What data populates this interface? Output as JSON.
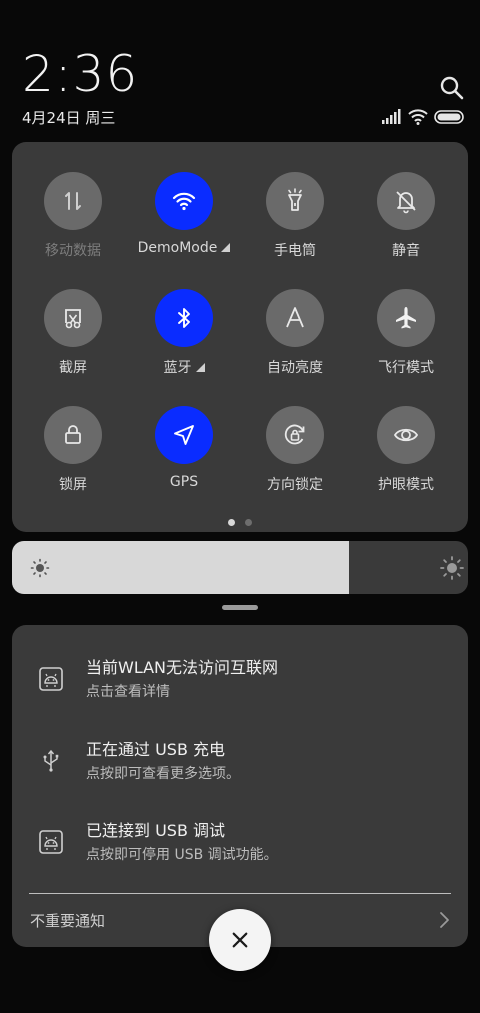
{
  "status_bar": {
    "time": "2:36",
    "date": "4月24日 周三",
    "signal_icon": "signal-icon",
    "wifi_icon": "wifi-icon",
    "battery_icon": "battery-icon",
    "search_icon": "search-icon"
  },
  "quick_settings": {
    "active_color": "#0a2cff",
    "inactive_color": "#6a6a6a",
    "tiles": [
      {
        "label": "移动数据",
        "icon": "mobile-data-icon",
        "state": "disabled"
      },
      {
        "label": "DemoMode",
        "icon": "wifi-icon",
        "state": "on",
        "has_more": true
      },
      {
        "label": "手电筒",
        "icon": "flashlight-icon",
        "state": "off"
      },
      {
        "label": "静音",
        "icon": "bell-off-icon",
        "state": "off"
      },
      {
        "label": "截屏",
        "icon": "screenshot-icon",
        "state": "off"
      },
      {
        "label": "蓝牙",
        "icon": "bluetooth-icon",
        "state": "on",
        "has_more": true
      },
      {
        "label": "自动亮度",
        "icon": "auto-brightness-icon",
        "state": "off"
      },
      {
        "label": "飞行模式",
        "icon": "airplane-icon",
        "state": "off"
      },
      {
        "label": "锁屏",
        "icon": "lock-icon",
        "state": "off"
      },
      {
        "label": "GPS",
        "icon": "location-arrow-icon",
        "state": "on"
      },
      {
        "label": "方向锁定",
        "icon": "rotation-lock-icon",
        "state": "off"
      },
      {
        "label": "护眼模式",
        "icon": "eye-icon",
        "state": "off"
      }
    ],
    "pages": 2,
    "current_page": 1
  },
  "brightness": {
    "level": 0.74
  },
  "notifications": [
    {
      "title": "当前WLAN无法访问互联网",
      "text": "点击查看详情",
      "icon": "android-debug-icon"
    },
    {
      "title": "正在通过 USB 充电",
      "text": "点按即可查看更多选项。",
      "icon": "usb-icon"
    },
    {
      "title": "已连接到 USB 调试",
      "text": "点按即可停用 USB 调试功能。",
      "icon": "android-debug-icon"
    }
  ],
  "unimportant_label": "不重要通知",
  "close_icon": "close-icon"
}
